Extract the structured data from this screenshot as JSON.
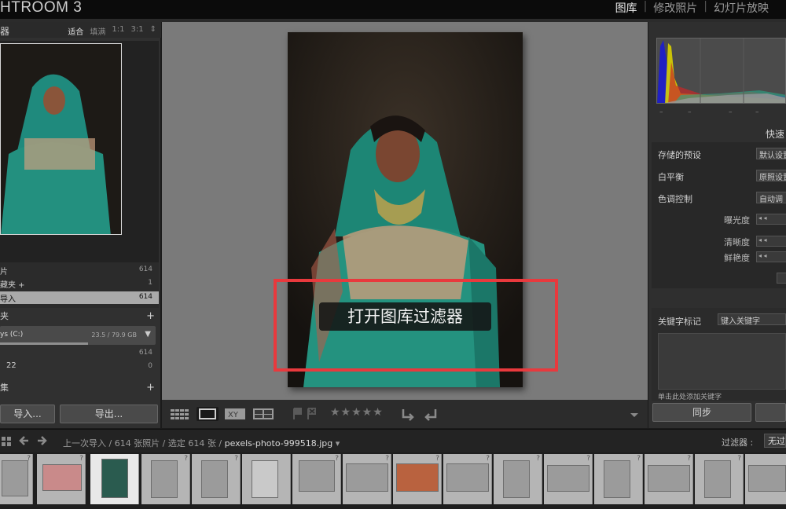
{
  "app": {
    "title": "HTROOM 3"
  },
  "modules": [
    "图库",
    "修改照片",
    "幻灯片放映"
  ],
  "navigator": {
    "title": "器",
    "options": [
      "适合",
      "填满",
      "1:1",
      "3:1"
    ]
  },
  "catalog": [
    {
      "label": "片",
      "count": "614"
    },
    {
      "label": "藏夹 +",
      "count": "1"
    },
    {
      "label": "导入",
      "count": "614"
    }
  ],
  "folders": {
    "title": "夹",
    "drive_label": "ys (C:)",
    "drive_usage": "23.5 / 79.9 GB",
    "counts": [
      "614",
      "0"
    ],
    "sub_label": "22"
  },
  "collections": {
    "title": "集"
  },
  "buttons": {
    "import": "导入...",
    "export": "导出...",
    "sync": "同步"
  },
  "overlay": {
    "label": "打开图库过滤器"
  },
  "toolbar": {
    "stars": "★★★★★"
  },
  "histogram": {
    "ticks": [
      "–",
      "–",
      "–",
      "–"
    ]
  },
  "quick_develop": {
    "title": "快速",
    "rows": [
      {
        "label": "存储的预设",
        "value": "默认设置"
      },
      {
        "label": "白平衡",
        "value": "原照设置"
      },
      {
        "label": "色调控制",
        "value": "自动调"
      }
    ],
    "sliders": [
      "曝光度",
      "清晰度",
      "鲜艳度"
    ]
  },
  "keywords": {
    "title": "关键字标记",
    "input": "键入关键字",
    "hint": "单击此处添加关键字"
  },
  "filmstrip": {
    "path_prefix": "上一次导入 / 614 张照片 / 选定 614 张 /",
    "file_name": "pexels-photo-999518.jpg",
    "filter_label": "过滤器 :",
    "filter_value": "无过"
  }
}
